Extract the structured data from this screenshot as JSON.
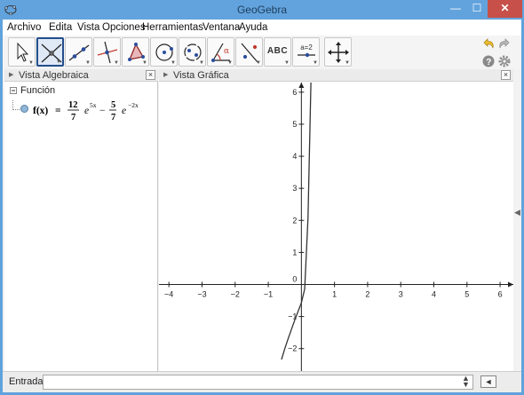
{
  "window": {
    "title": "GeoGebra",
    "min_label": "—",
    "max_label": "☐",
    "close_label": "✕"
  },
  "menubar": {
    "items": [
      "Archivo",
      "Edita",
      "Vista",
      "Opciones",
      "Herramientas",
      "Ventana",
      "Ayuda"
    ]
  },
  "toolbar": {
    "tools": [
      {
        "icon": "move-arrow-icon"
      },
      {
        "icon": "intersect-point-icon",
        "selected": true
      },
      {
        "icon": "line-through-points-icon"
      },
      {
        "icon": "perpendicular-line-icon"
      },
      {
        "icon": "polygon-icon"
      },
      {
        "icon": "circle-center-point-icon"
      },
      {
        "icon": "ellipse-icon"
      },
      {
        "icon": "angle-icon"
      },
      {
        "icon": "reflect-line-icon"
      },
      {
        "icon": "text-tool-icon",
        "label": "ABC"
      },
      {
        "icon": "slider-icon",
        "label": "a=2"
      },
      {
        "icon": "move-graphics-view-icon"
      }
    ],
    "undo_icon": "undo-icon",
    "redo_icon": "redo-icon",
    "help_icon": "help-icon",
    "settings_icon": "settings-gear-icon"
  },
  "algebra_view": {
    "title": "Vista Algebraica",
    "close": "×",
    "category": "Función",
    "formula": {
      "name": "f(x)",
      "eq": "=",
      "c1_num": "12",
      "c1_den": "7",
      "base1": "e",
      "exp1": "5x",
      "minus": "−",
      "c2_num": "5",
      "c2_den": "7",
      "base2": "e",
      "exp2": "−2x"
    }
  },
  "graphics_view": {
    "title": "Vista Gráfica",
    "close": "×"
  },
  "input_bar": {
    "label": "Entrada:",
    "value": "",
    "placeholder": ""
  },
  "chart_data": {
    "type": "line",
    "title": "",
    "xlabel": "",
    "ylabel": "",
    "xlim": [
      -4.3,
      6.4
    ],
    "ylim": [
      -2.7,
      6.3
    ],
    "x_ticks": [
      -4,
      -3,
      -2,
      -1,
      1,
      2,
      3,
      4,
      5,
      6
    ],
    "y_ticks": [
      -2,
      -1,
      1,
      2,
      3,
      4,
      5,
      6
    ],
    "origin_label": "0",
    "grid": false,
    "function": "f(x) = 12/7 e^(5x) − 5/7 e^(−2x)",
    "series": [
      {
        "color": "#333333",
        "x": [
          -0.6,
          -0.5,
          -0.4,
          -0.3,
          -0.2,
          -0.1,
          0.0,
          0.1,
          0.2,
          0.3,
          0.4,
          0.45
        ],
        "y": [
          -2.34,
          -2.0,
          -1.69,
          -1.4,
          -1.11,
          -0.84,
          -0.57,
          -0.14,
          2.07,
          6.86,
          12.43,
          16.17
        ]
      }
    ]
  }
}
